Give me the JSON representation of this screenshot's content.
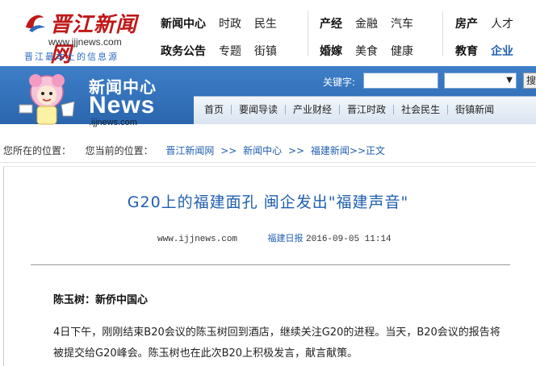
{
  "site": {
    "logo_title": "晋江新闻网",
    "logo_url": "www.ijjnews.com",
    "logo_slogan": "晋江最本土的信息源"
  },
  "topnav": {
    "group1": {
      "row1": [
        "新闻中心",
        "时政",
        "民生"
      ],
      "row2": [
        "政务公告",
        "专题",
        "街镇"
      ]
    },
    "group2": {
      "row1": [
        "产经",
        "金融",
        "汽车"
      ],
      "row2": [
        "婚嫁",
        "美食",
        "健康"
      ]
    },
    "group3": {
      "row1": [
        "房产",
        "人才"
      ],
      "row2": [
        "教育",
        "企业"
      ]
    }
  },
  "section": {
    "title": "新闻中心",
    "news_word": "News",
    "url": ".ijjnews.com"
  },
  "search": {
    "label": "关键字:",
    "input_value": "",
    "select_value": "",
    "button_label": "搜"
  },
  "subnav": [
    "首页",
    "要闻导读",
    "产业财经",
    "晋江时政",
    "社会民生",
    "街镇新闻"
  ],
  "breadcrumb": {
    "prefix": "您所在的位置：",
    "current_label": "您当前的位置：",
    "items": [
      "晋江新闻网",
      "新闻中心",
      "福建新闻"
    ],
    "sep": ">>",
    "tail": ">>正文"
  },
  "article": {
    "title": "G20上的福建面孔 闽企发出\"福建声音\"",
    "meta_url": "www.ijjnews.com",
    "meta_source": "福建日报",
    "meta_time": "2016-09-05 11:14",
    "subhead": "陈玉树：新侨中国心",
    "paragraph": "4日下午，刚刚结束B20会议的陈玉树回到酒店，继续关注G20的进程。当天，B20会议的报告将被提交给G20峰会。陈玉树也在此次B20上积极发言，献言献策。"
  },
  "colors": {
    "brand_red": "#c01818",
    "link_blue": "#1f5fae",
    "banner_blue": "#2b66ae"
  }
}
